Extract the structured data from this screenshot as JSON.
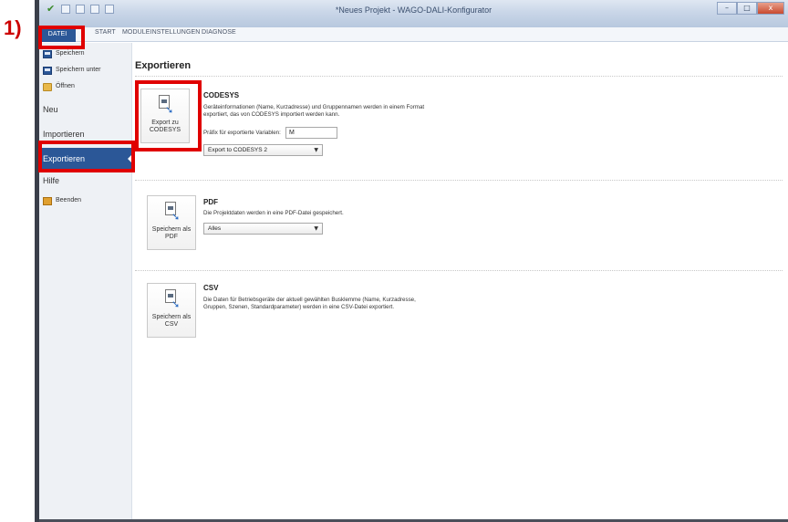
{
  "window": {
    "title": "*Neues Projekt - WAGO-DALI-Konfigurator",
    "minimize_glyph": "–",
    "maximize_glyph": "□",
    "close_glyph": "x"
  },
  "annotation": {
    "step_label": "1)",
    "color": "#e00000"
  },
  "ribbon": {
    "tabs": [
      {
        "label": "DATEI"
      },
      {
        "label": "START"
      },
      {
        "label": "MODULEINSTELLUNGEN"
      },
      {
        "label": "DIAGNOSE"
      }
    ]
  },
  "sidebar": {
    "items": [
      {
        "label": "Speichern",
        "icon": "floppy-disk-icon"
      },
      {
        "label": "Speichern unter",
        "icon": "floppy-disk-icon"
      },
      {
        "label": "Öffnen",
        "icon": "folder-icon"
      },
      {
        "label": "Neu"
      },
      {
        "label": "Importieren"
      },
      {
        "label": "Exportieren"
      },
      {
        "label": "Hilfe"
      },
      {
        "label": "Beenden",
        "icon": "exit-icon"
      }
    ]
  },
  "main": {
    "heading": "Exportieren",
    "sections": [
      {
        "tile_label": "Export zu CODESYS",
        "title": "CODESYS",
        "description": "Geräteinformationen (Name, Kurzadresse) und Gruppennamen werden in einem Format exportiert, das von CODESYS importiert werden kann.",
        "prefix_label": "Präfix für exportierte Variablen:",
        "prefix_value": "M",
        "combo_value": "Export to CODESYS 2"
      },
      {
        "tile_label": "Speichern als PDF",
        "title": "PDF",
        "description": "Die Projektdaten werden in eine PDF-Datei gespeichert.",
        "combo_value": "Alles"
      },
      {
        "tile_label": "Speichern als CSV",
        "title": "CSV",
        "description": "Die Daten für Betriebsgeräte der aktuell gewählten Busklemme (Name, Kurzadresse, Gruppen, Szenen, Standardparameter) werden in eine CSV-Datei exportiert."
      }
    ]
  },
  "colors": {
    "accent": "#2b5797",
    "highlight": "#e00000"
  }
}
